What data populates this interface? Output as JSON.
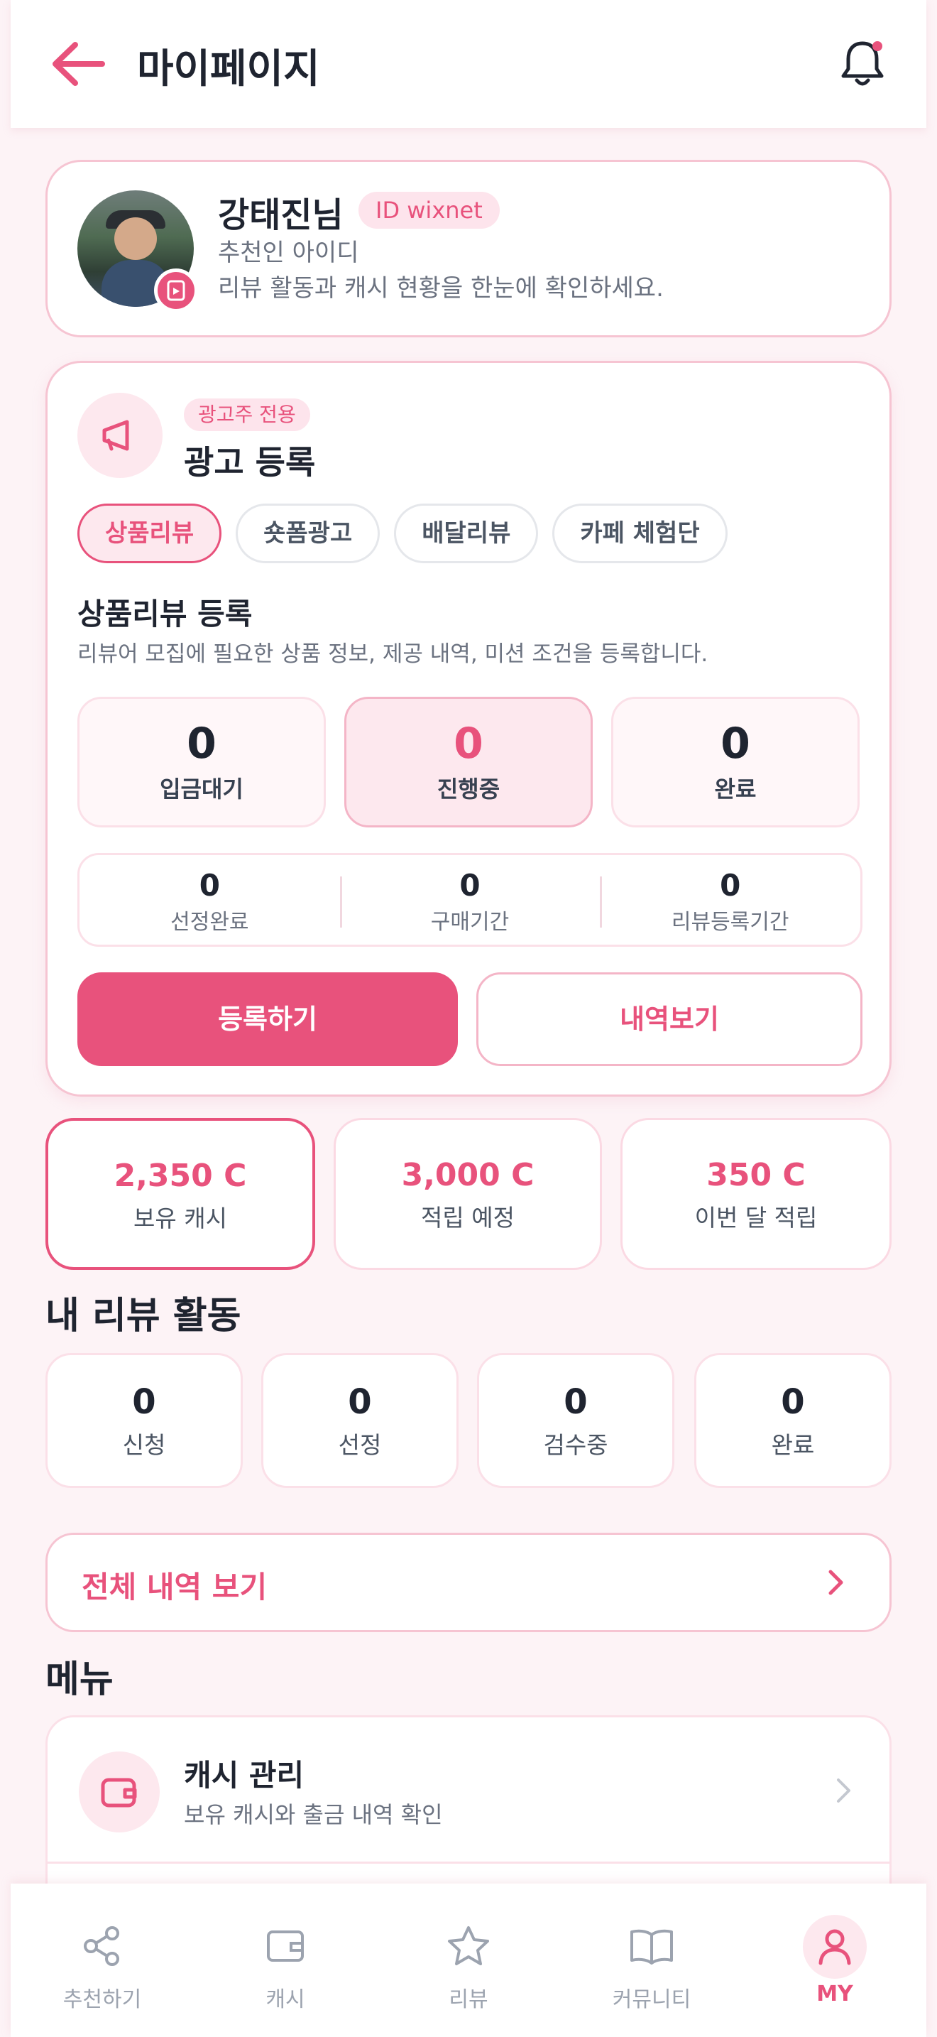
{
  "header": {
    "title": "마이페이지",
    "back_icon": "arrow-left-icon",
    "bell_icon": "bell-icon"
  },
  "profile": {
    "name": "강태진님",
    "id_badge": "ID wixnet",
    "subtitle": "추천인 아이디",
    "description": "리뷰 활동과 캐시 현황을 한눈에 확인하세요."
  },
  "ad": {
    "tag": "광고주 전용",
    "title": "광고 등록",
    "icon": "megaphone-icon",
    "tabs": [
      {
        "label": "상품리뷰",
        "active": true
      },
      {
        "label": "숏폼광고",
        "active": false
      },
      {
        "label": "배달리뷰",
        "active": false
      },
      {
        "label": "카페 체험단",
        "active": false
      }
    ],
    "section_title": "상품리뷰 등록",
    "section_desc": "리뷰어 모집에 필요한 상품 정보, 제공 내역, 미션 조건을 등록합니다.",
    "stats": [
      {
        "value": "0",
        "label": "입금대기"
      },
      {
        "value": "0",
        "label": "진행중"
      },
      {
        "value": "0",
        "label": "완료"
      }
    ],
    "substats": [
      {
        "value": "0",
        "label": "선정완료"
      },
      {
        "value": "0",
        "label": "구매기간"
      },
      {
        "value": "0",
        "label": "리뷰등록기간"
      }
    ],
    "primary_button": "등록하기",
    "secondary_button": "내역보기"
  },
  "cash": [
    {
      "value": "2,350 C",
      "label": "보유 캐시"
    },
    {
      "value": "3,000 C",
      "label": "적립 예정"
    },
    {
      "value": "350 C",
      "label": "이번 달 적립"
    }
  ],
  "review_activity": {
    "title": "내 리뷰 활동",
    "items": [
      {
        "value": "0",
        "label": "신청"
      },
      {
        "value": "0",
        "label": "선정"
      },
      {
        "value": "0",
        "label": "검수중"
      },
      {
        "value": "0",
        "label": "완료"
      }
    ]
  },
  "all_history": {
    "label": "전체 내역 보기"
  },
  "menu": {
    "title": "메뉴",
    "items": [
      {
        "label": "캐시 관리",
        "desc": "보유 캐시와 출금 내역 확인",
        "icon": "wallet-icon"
      }
    ]
  },
  "bottom_nav": [
    {
      "label": "추천하기",
      "icon": "share-icon"
    },
    {
      "label": "캐시",
      "icon": "wallet-icon"
    },
    {
      "label": "리뷰",
      "icon": "star-icon"
    },
    {
      "label": "커뮤니티",
      "icon": "book-icon"
    },
    {
      "label": "MY",
      "icon": "user-icon",
      "active": true
    }
  ],
  "colors": {
    "accent": "#e8527c",
    "accent_light": "#fde8ee",
    "background": "#fdf3f6"
  }
}
